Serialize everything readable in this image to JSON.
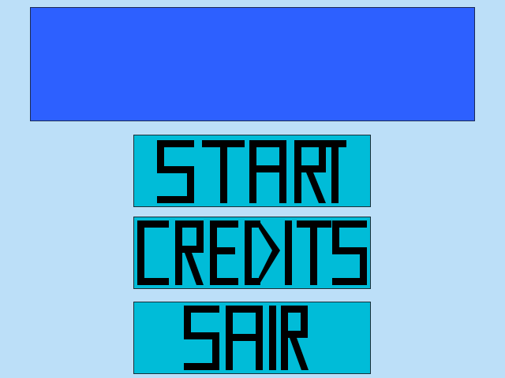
{
  "menu": {
    "items": [
      {
        "label": "START"
      },
      {
        "label": "CREDITS"
      },
      {
        "label": "SAIR"
      }
    ]
  },
  "colors": {
    "background": "#bcdff8",
    "title_panel": "#2d60ff",
    "button_fill": "#00bcd8",
    "glyph": "#000000"
  }
}
